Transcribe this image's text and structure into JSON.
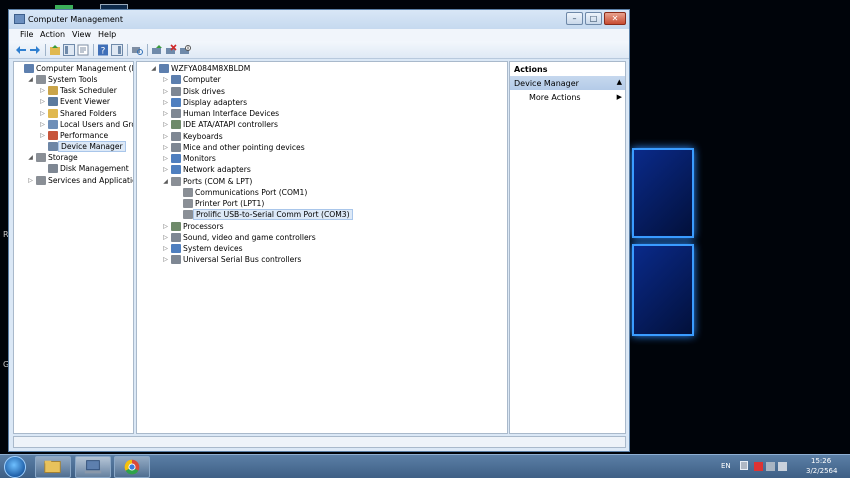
{
  "window": {
    "title": "Computer Management"
  },
  "menu": [
    "File",
    "Action",
    "View",
    "Help"
  ],
  "left_tree": [
    {
      "label": "Computer Management (Local",
      "indent": 0,
      "arrow": "",
      "icon": "computer-management-icon",
      "color": "#5d7fae"
    },
    {
      "label": "System Tools",
      "indent": 1,
      "arrow": "◢",
      "icon": "tools-icon",
      "color": "#8a8f96"
    },
    {
      "label": "Task Scheduler",
      "indent": 2,
      "arrow": "▷",
      "icon": "clock-icon",
      "color": "#c9a449"
    },
    {
      "label": "Event Viewer",
      "indent": 2,
      "arrow": "▷",
      "icon": "event-viewer-icon",
      "color": "#5b7a9e"
    },
    {
      "label": "Shared Folders",
      "indent": 2,
      "arrow": "▷",
      "icon": "folder-icon",
      "color": "#e0b84f"
    },
    {
      "label": "Local Users and Groups",
      "indent": 2,
      "arrow": "▷",
      "icon": "users-icon",
      "color": "#6f8fb8"
    },
    {
      "label": "Performance",
      "indent": 2,
      "arrow": "▷",
      "icon": "performance-icon",
      "color": "#c7553b"
    },
    {
      "label": "Device Manager",
      "indent": 2,
      "arrow": "",
      "icon": "device-manager-icon",
      "color": "#6d86a6",
      "selected": true
    },
    {
      "label": "Storage",
      "indent": 1,
      "arrow": "◢",
      "icon": "storage-icon",
      "color": "#8a8f96"
    },
    {
      "label": "Disk Management",
      "indent": 2,
      "arrow": "",
      "icon": "disk-icon",
      "color": "#7e8793"
    },
    {
      "label": "Services and Applications",
      "indent": 1,
      "arrow": "▷",
      "icon": "services-icon",
      "color": "#8a8f96"
    }
  ],
  "device_tree": [
    {
      "label": "WZFYA084M8XBLDM",
      "indent": 0,
      "arrow": "◢",
      "icon": "computer-icon",
      "color": "#5d7fae"
    },
    {
      "label": "Computer",
      "indent": 1,
      "arrow": "▷",
      "icon": "computer-icon",
      "color": "#5d7fae"
    },
    {
      "label": "Disk drives",
      "indent": 1,
      "arrow": "▷",
      "icon": "disk-drive-icon",
      "color": "#7e8793"
    },
    {
      "label": "Display adapters",
      "indent": 1,
      "arrow": "▷",
      "icon": "display-adapter-icon",
      "color": "#4f7fbf"
    },
    {
      "label": "Human Interface Devices",
      "indent": 1,
      "arrow": "▷",
      "icon": "hid-icon",
      "color": "#7e8793"
    },
    {
      "label": "IDE ATA/ATAPI controllers",
      "indent": 1,
      "arrow": "▷",
      "icon": "ide-controller-icon",
      "color": "#6e8a6a"
    },
    {
      "label": "Keyboards",
      "indent": 1,
      "arrow": "▷",
      "icon": "keyboard-icon",
      "color": "#7e8793"
    },
    {
      "label": "Mice and other pointing devices",
      "indent": 1,
      "arrow": "▷",
      "icon": "mouse-icon",
      "color": "#7e8793"
    },
    {
      "label": "Monitors",
      "indent": 1,
      "arrow": "▷",
      "icon": "monitor-icon",
      "color": "#4f7fbf"
    },
    {
      "label": "Network adapters",
      "indent": 1,
      "arrow": "▷",
      "icon": "network-adapter-icon",
      "color": "#4f7fbf"
    },
    {
      "label": "Ports (COM & LPT)",
      "indent": 1,
      "arrow": "◢",
      "icon": "port-icon",
      "color": "#8a8f96"
    },
    {
      "label": "Communications Port (COM1)",
      "indent": 2,
      "arrow": "",
      "icon": "port-icon",
      "color": "#8a8f96"
    },
    {
      "label": "Printer Port (LPT1)",
      "indent": 2,
      "arrow": "",
      "icon": "port-icon",
      "color": "#8a8f96"
    },
    {
      "label": "Prolific USB-to-Serial Comm Port (COM3)",
      "indent": 2,
      "arrow": "",
      "icon": "port-icon",
      "color": "#8a8f96",
      "selected": true
    },
    {
      "label": "Processors",
      "indent": 1,
      "arrow": "▷",
      "icon": "processor-icon",
      "color": "#6e8a6a"
    },
    {
      "label": "Sound, video and game controllers",
      "indent": 1,
      "arrow": "▷",
      "icon": "sound-icon",
      "color": "#7e8793"
    },
    {
      "label": "System devices",
      "indent": 1,
      "arrow": "▷",
      "icon": "system-device-icon",
      "color": "#4f7fbf"
    },
    {
      "label": "Universal Serial Bus controllers",
      "indent": 1,
      "arrow": "▷",
      "icon": "usb-icon",
      "color": "#7e8793"
    }
  ],
  "actions": {
    "header": "Actions",
    "section": "Device Manager",
    "more": "More Actions"
  },
  "tray": {
    "language": "EN",
    "time": "15:26",
    "date": "3/2/2564"
  },
  "desktop_edge": [
    "R",
    "G"
  ]
}
